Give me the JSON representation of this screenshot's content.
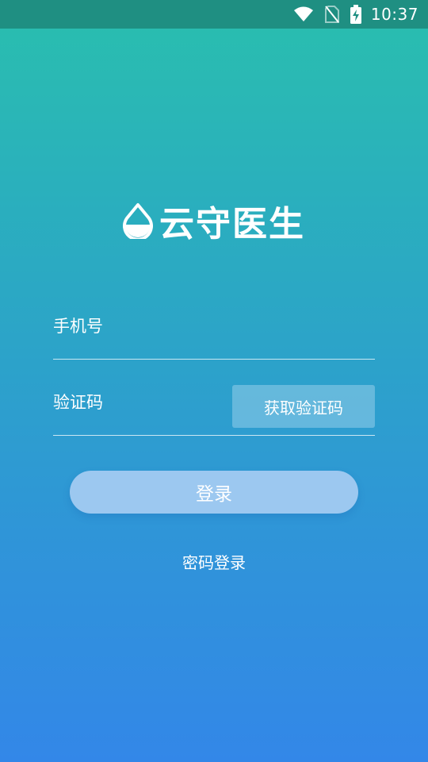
{
  "status_bar": {
    "time": "10:37",
    "icons": [
      "wifi-icon",
      "no-sim-icon",
      "battery-charging-icon"
    ]
  },
  "app": {
    "name": "云守医生",
    "logo_icon": "water-drop-icon"
  },
  "form": {
    "phone_placeholder": "手机号",
    "code_placeholder": "验证码",
    "get_code_label": "获取验证码",
    "login_label": "登录",
    "password_login_label": "密码登录"
  },
  "colors": {
    "gradient_top": "#29bfae",
    "gradient_bottom": "#3387e8",
    "status_bar": "#1f8f82",
    "login_button": "#9cc8f0"
  }
}
